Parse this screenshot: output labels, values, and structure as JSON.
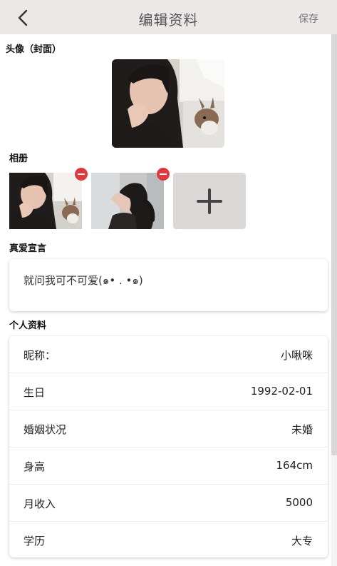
{
  "header": {
    "back_icon": "chevron-left-icon",
    "title": "编辑资料",
    "save_label": "保存"
  },
  "avatar_section": {
    "label": "头像（封面）"
  },
  "album_section": {
    "label": "相册",
    "remove_icon": "remove-icon",
    "add_icon": "plus-icon"
  },
  "declaration_section": {
    "label": "真爱宣言",
    "text": "就问我可不可爱(๑• . •๑)"
  },
  "profile_section": {
    "label": "个人资料",
    "rows": [
      {
        "label": "昵称：",
        "value": "小啾咪"
      },
      {
        "label": "生日",
        "value": "1992-02-01"
      },
      {
        "label": "婚姻状况",
        "value": "未婚"
      },
      {
        "label": "身高",
        "value": "164cm"
      },
      {
        "label": "月收入",
        "value": "5000"
      },
      {
        "label": "学历",
        "value": "大专"
      }
    ]
  },
  "colors": {
    "header_bg": "#ebe8e7",
    "remove_badge": "#e0393e",
    "add_tile_bg": "#dcd8d8"
  }
}
